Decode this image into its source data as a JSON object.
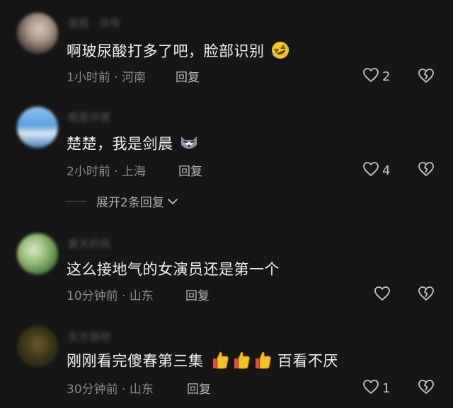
{
  "comments": [
    {
      "username": "张凯 · 许传",
      "text": "啊玻尿酸打多了吧，脸部识别",
      "emoji": [
        "rolling-laughing-emoji"
      ],
      "meta": "1小时前 · 河南",
      "reply_label": "回复",
      "likes": "2"
    },
    {
      "username": "我是许佬",
      "text": "楚楚，我是剑晨",
      "emoji": [
        "wolf-emoji"
      ],
      "meta": "2小时前 · 上海",
      "reply_label": "回复",
      "likes": "4"
    },
    {
      "username": "夏天的风",
      "text": "这么接地气的女演员还是第一个",
      "emoji": [],
      "meta": "10分钟前 · 山东",
      "reply_label": "回复",
      "likes": ""
    },
    {
      "username": "东方哥吧",
      "text": "刚刚看完傻春第三集",
      "text_after": "百看不厌",
      "emoji": [
        "thumbs-up-emoji",
        "thumbs-up-emoji",
        "thumbs-up-emoji"
      ],
      "meta": "30分钟前 · 山东",
      "reply_label": "回复",
      "likes": "1"
    }
  ],
  "expand_replies": {
    "label": "展开2条回复"
  },
  "colors": {
    "background": "#161616",
    "text": "#f2f2f2",
    "meta": "#8a8a8a"
  }
}
